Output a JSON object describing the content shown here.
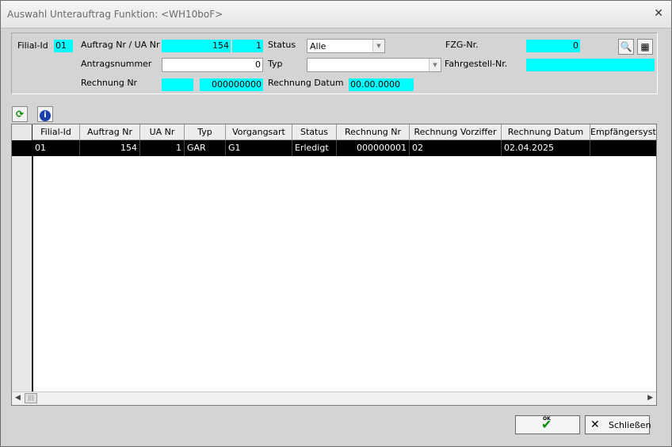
{
  "window": {
    "title": "Auswahl Unterauftrag Funktion: <WH10boF>"
  },
  "filter": {
    "filial_label": "Filial-Id",
    "filial_value": "01",
    "auftrag_label": "Auftrag Nr  / UA Nr",
    "auftrag_value": "154",
    "ua_value": "1",
    "status_label": "Status",
    "status_value": "Alle",
    "fzg_label": "FZG-Nr.",
    "fzg_value": "0",
    "antrag_label": "Antragsnummer",
    "antrag_value": "0",
    "typ_label": "Typ",
    "typ_value": "",
    "fahrgestell_label": "Fahrgestell-Nr.",
    "fahrgestell_value": "",
    "rechnung_label": "Rechnung Nr",
    "rechnung_prefix": "",
    "rechnung_value": "000000000",
    "rechnung_datum_label": "Rechnung Datum",
    "rechnung_datum_value": "00.00.0000"
  },
  "table": {
    "columns": [
      "Filial-Id",
      "Auftrag Nr",
      "UA Nr",
      "Typ",
      "Vorgangsart",
      "Status",
      "Rechnung Nr",
      "Rechnung Vorziffer",
      "Rechnung Datum",
      "Empfängersyste"
    ],
    "rows": [
      [
        "01",
        "154",
        "1",
        "GAR",
        "G1",
        "Erledigt",
        "000000001",
        "02",
        "02.04.2025",
        ""
      ]
    ]
  },
  "buttons": {
    "ok_label": "OK",
    "close_label": "Schließen"
  },
  "colors": {
    "field_cyan": "#00ffff",
    "selected_row": "#000000"
  }
}
